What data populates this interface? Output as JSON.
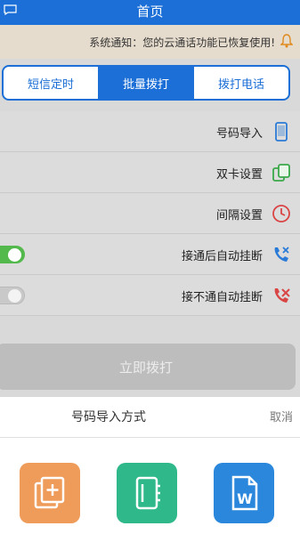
{
  "header": {
    "title": "首页"
  },
  "notice": {
    "text": "系统通知：您的云通话功能已恢复使用!"
  },
  "tabs": [
    {
      "label": "短信定时",
      "active": false
    },
    {
      "label": "批量拨打",
      "active": true
    },
    {
      "label": "拨打电话",
      "active": false
    }
  ],
  "settings": [
    {
      "label": "号码导入",
      "icon": "phone-device-icon"
    },
    {
      "label": "双卡设置",
      "icon": "dual-sim-icon"
    },
    {
      "label": "间隔设置",
      "icon": "clock-icon"
    },
    {
      "label": "接通后自动挂断",
      "icon": "call-connected-icon",
      "toggle": true
    },
    {
      "label": "接不通自动挂断",
      "icon": "call-failed-icon",
      "toggle": false
    }
  ],
  "call_button": {
    "label": "立即拨打"
  },
  "sheet": {
    "title": "号码导入方式",
    "cancel": "取消",
    "options": [
      {
        "label": "",
        "icon": "gallery-import-icon"
      },
      {
        "label": "",
        "icon": "contacts-import-icon"
      },
      {
        "label": "",
        "icon": "word-import-icon"
      }
    ]
  },
  "colors": {
    "brand": "#1b6fd6",
    "toggle_on": "#53b94c",
    "notice_bg": "#e6dccd"
  }
}
